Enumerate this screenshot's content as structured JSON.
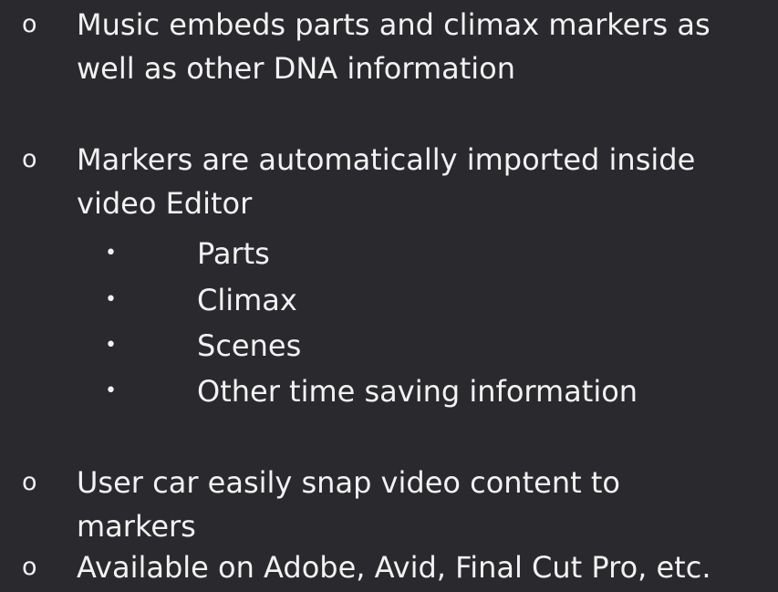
{
  "bullets": {
    "primary_symbol": "o",
    "secondary_symbol": "•"
  },
  "items": [
    {
      "lines": [
        "Music embeds parts and climax markers as",
        "well as other DNA information"
      ]
    },
    {
      "lines": [
        "Markers are automatically imported inside",
        "video Editor"
      ],
      "sub_items": [
        "Parts",
        "Climax",
        "Scenes",
        "Other time saving information"
      ]
    },
    {
      "lines": [
        "User car easily snap video content to",
        "markers"
      ]
    },
    {
      "lines": [
        "Available on Adobe, Avid, Final Cut Pro, etc."
      ]
    }
  ],
  "colors": {
    "background": "#2a2a2e",
    "text": "#f2f2f2"
  }
}
